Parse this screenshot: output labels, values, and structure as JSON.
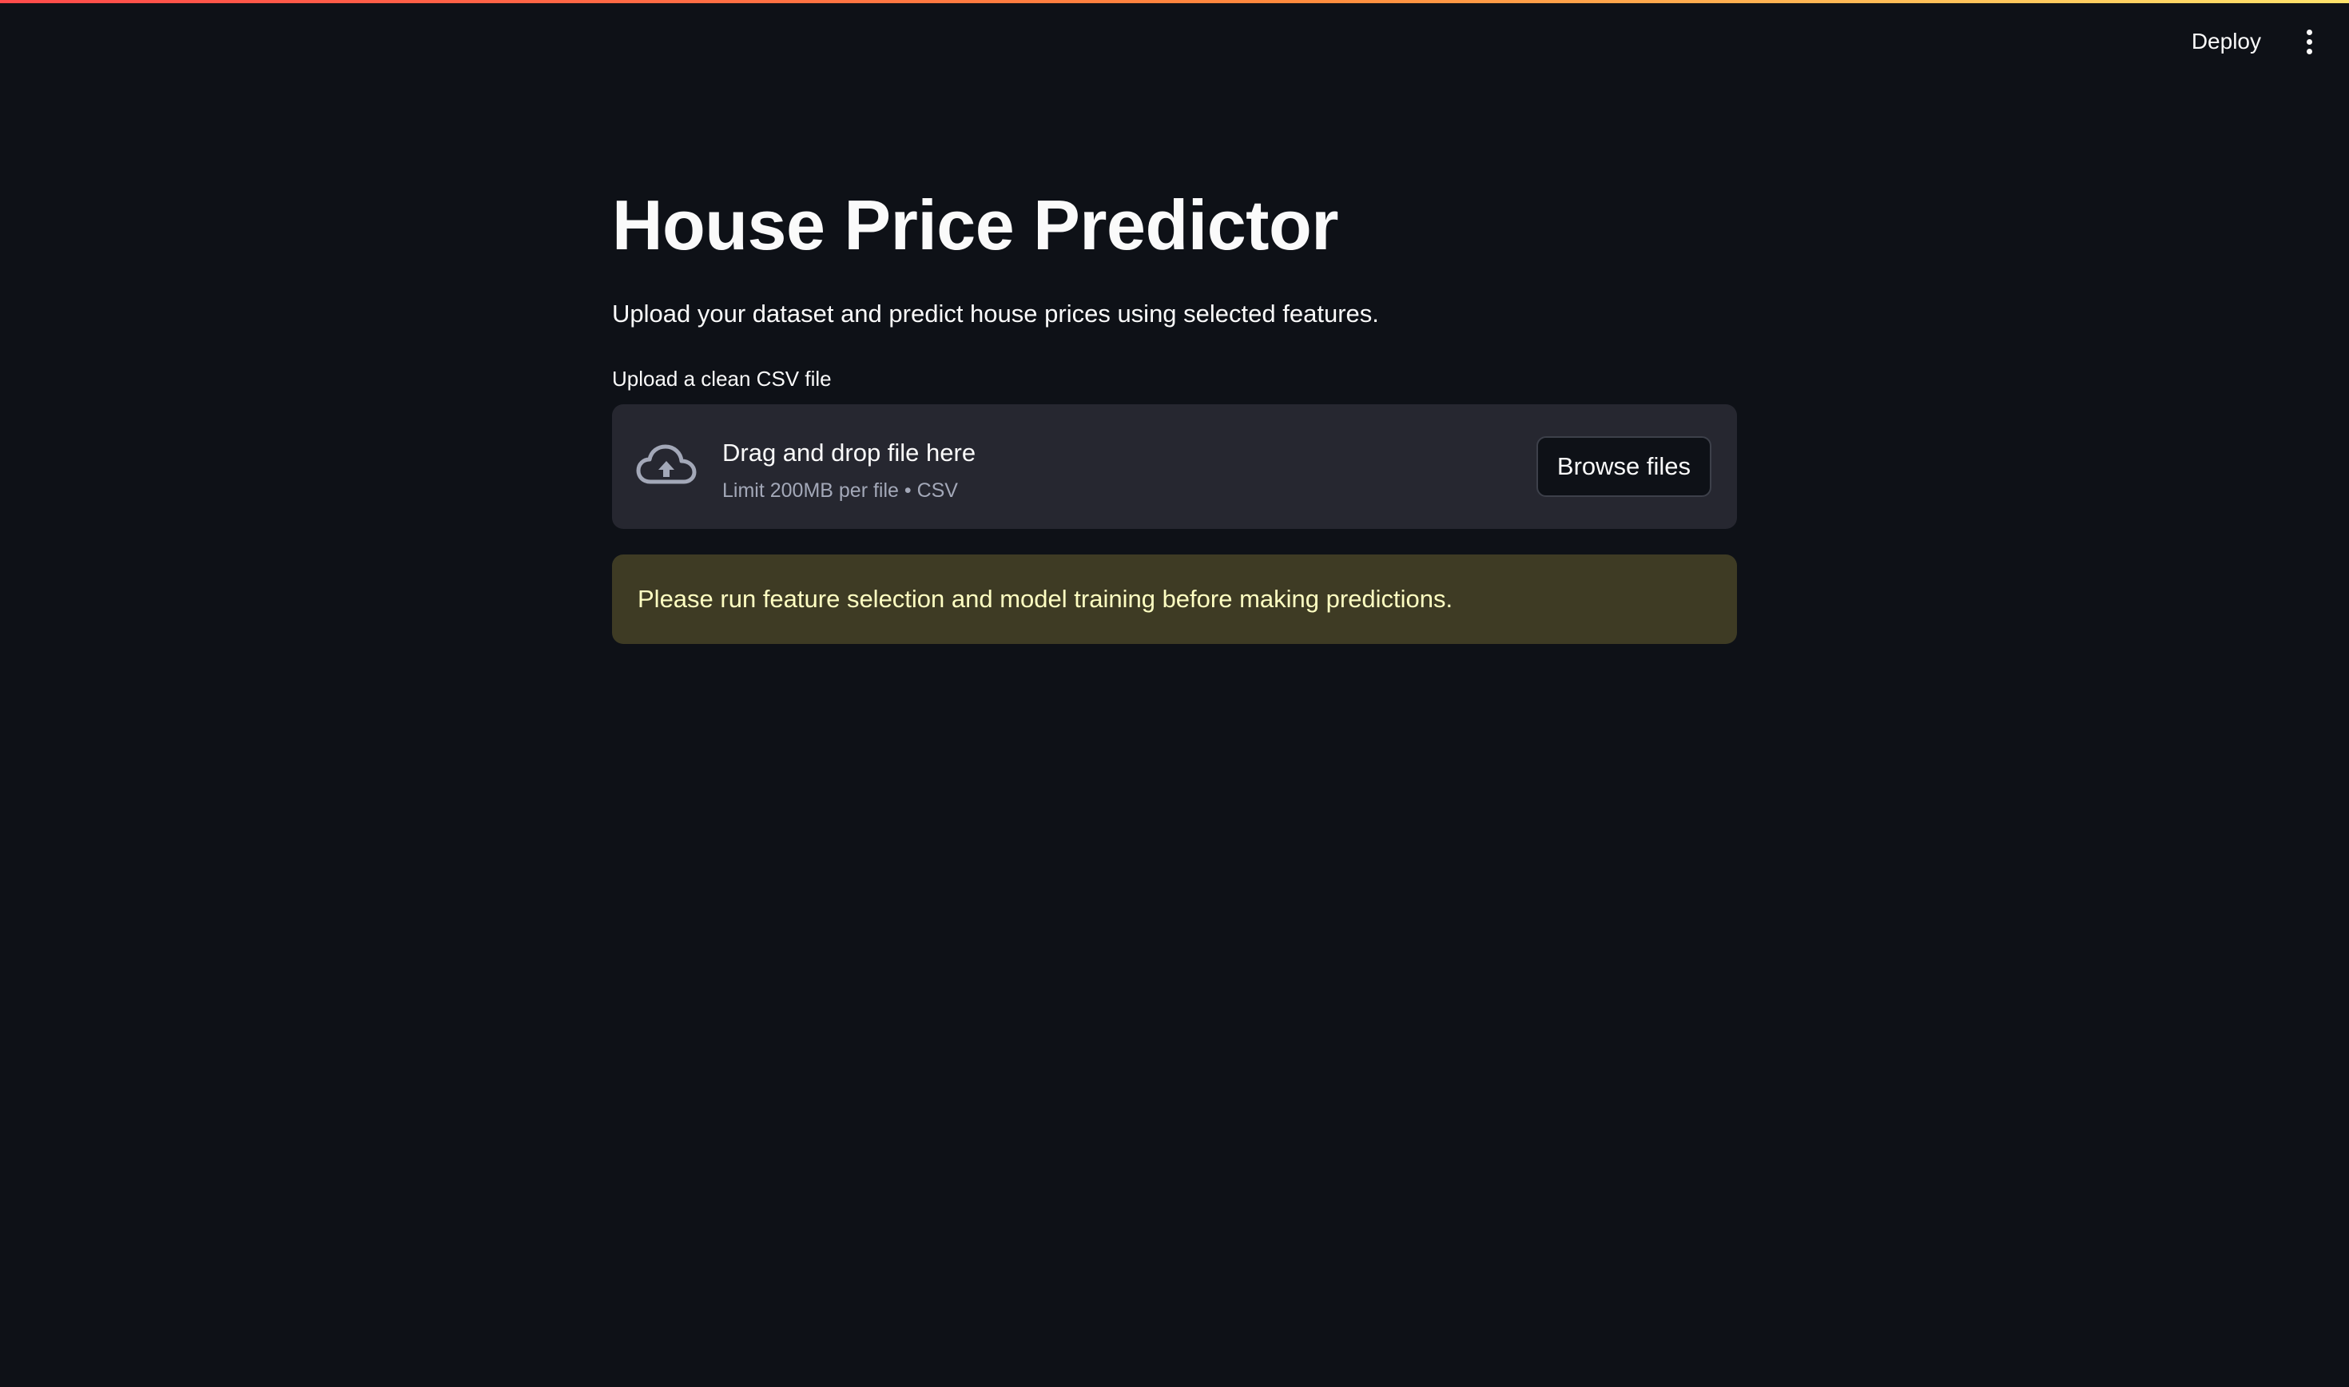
{
  "header": {
    "deploy_label": "Deploy",
    "menu_icon": "vertical-ellipsis-icon"
  },
  "main": {
    "title": "House Price Predictor",
    "description": "Upload your dataset and predict house prices using selected features."
  },
  "uploader": {
    "label": "Upload a clean CSV file",
    "dropzone_title": "Drag and drop file here",
    "dropzone_limit": "Limit 200MB per file • CSV",
    "browse_label": "Browse files",
    "icon": "cloud-upload-icon"
  },
  "alert": {
    "type": "warning",
    "message": "Please run feature selection and model training before making predictions."
  },
  "colors": {
    "background": "#0e1117",
    "text": "#fafafa",
    "dropzone_bg": "#262730",
    "alert_bg": "#3e3b24",
    "alert_text": "#ffffc2",
    "accent_gradient_start": "#ff4b4b",
    "accent_gradient_end": "#ffe36b"
  }
}
